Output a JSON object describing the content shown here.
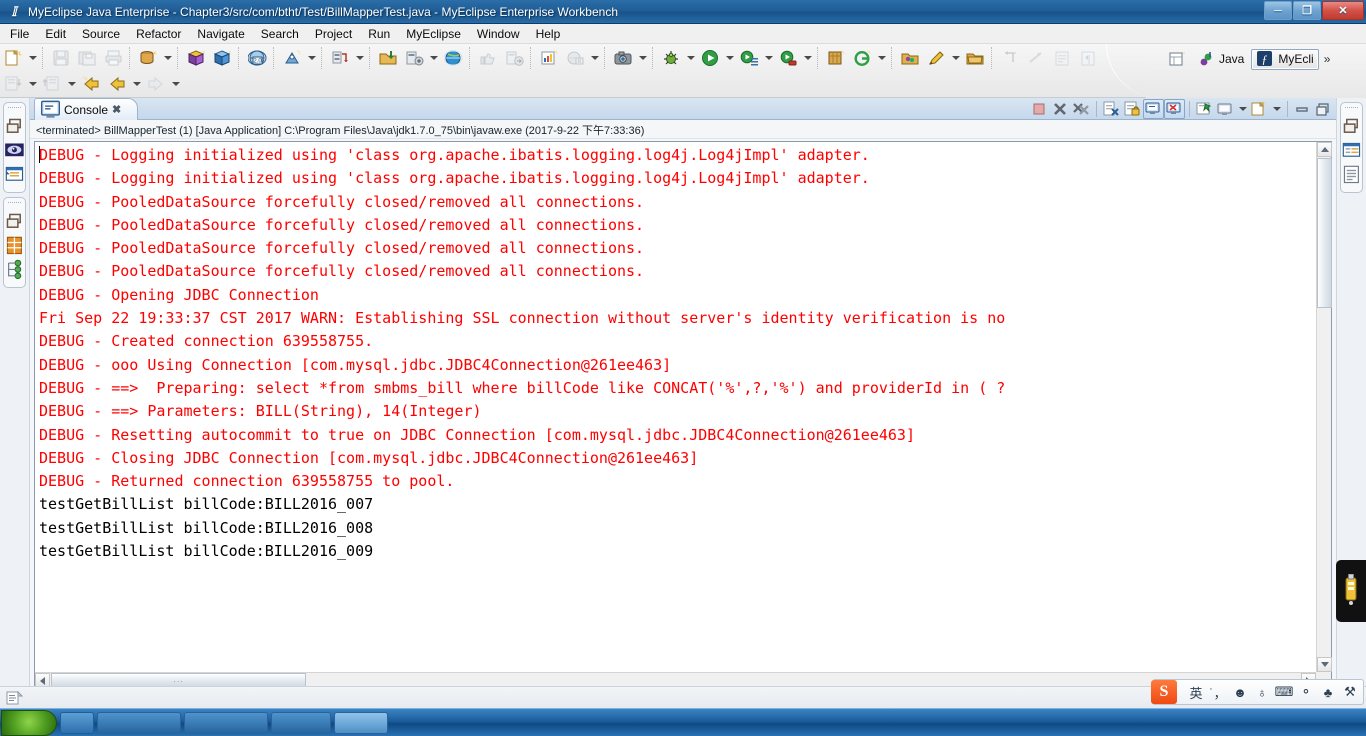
{
  "window": {
    "title": "MyEclipse Java Enterprise - Chapter3/src/com/btht/Test/BillMapperTest.java - MyEclipse Enterprise Workbench",
    "app_icon": "myeclipse-icon",
    "minimize_label": "─",
    "maximize_label": "❐",
    "close_label": "✕"
  },
  "menubar": {
    "items": [
      {
        "label": "File"
      },
      {
        "label": "Edit"
      },
      {
        "label": "Source"
      },
      {
        "label": "Refactor"
      },
      {
        "label": "Navigate"
      },
      {
        "label": "Search"
      },
      {
        "label": "Project"
      },
      {
        "label": "Run"
      },
      {
        "label": "MyEclipse"
      },
      {
        "label": "Window"
      },
      {
        "label": "Help"
      }
    ]
  },
  "perspective": {
    "items": [
      {
        "label": "Java",
        "icon": "java-perspective-icon",
        "active": false
      },
      {
        "label": "MyEcli",
        "icon": "myeclipse-perspective-icon",
        "active": true
      }
    ],
    "overflow_label": "»",
    "open_perspective_icon": "open-perspective-icon"
  },
  "console_view": {
    "tab_label": "Console",
    "tab_icon": "console-icon",
    "tab_close_label": "✖",
    "status_line": "<terminated> BillMapperTest (1) [Java Application] C:\\Program Files\\Java\\jdk1.7.0_75\\bin\\javaw.exe (2017-9-22 下午7:33:36)",
    "toolbar": [
      {
        "name": "terminate-button",
        "icon": "stop-square-icon",
        "pressed": false
      },
      {
        "name": "remove-launch-button",
        "icon": "remove-x-icon",
        "pressed": false
      },
      {
        "name": "remove-all-terminated-button",
        "icon": "remove-all-xx-icon",
        "pressed": false
      },
      {
        "name": "clear-console-button",
        "icon": "clear-console-icon",
        "pressed": false
      },
      {
        "name": "scroll-lock-button",
        "icon": "scroll-lock-icon",
        "pressed": false
      },
      {
        "name": "show-console-on-output-button",
        "icon": "console-out-icon",
        "pressed": true
      },
      {
        "name": "show-console-on-error-button",
        "icon": "console-err-icon",
        "pressed": true
      },
      {
        "name": "pin-console-button",
        "icon": "pin-console-icon",
        "pressed": false
      },
      {
        "name": "display-selected-console-button",
        "icon": "display-console-icon",
        "pressed": false
      },
      {
        "name": "open-console-button",
        "icon": "open-console-icon",
        "pressed": false
      },
      {
        "name": "minimize-view-button",
        "icon": "minimize-icon",
        "pressed": false
      },
      {
        "name": "maximize-view-button",
        "icon": "maximize-icon",
        "pressed": false
      }
    ],
    "output_lines": [
      {
        "text": "DEBUG - Logging initialized using 'class org.apache.ibatis.logging.log4j.Log4jImpl' adapter.",
        "stream": "err"
      },
      {
        "text": "DEBUG - Logging initialized using 'class org.apache.ibatis.logging.log4j.Log4jImpl' adapter.",
        "stream": "err"
      },
      {
        "text": "DEBUG - PooledDataSource forcefully closed/removed all connections.",
        "stream": "err"
      },
      {
        "text": "DEBUG - PooledDataSource forcefully closed/removed all connections.",
        "stream": "err"
      },
      {
        "text": "DEBUG - PooledDataSource forcefully closed/removed all connections.",
        "stream": "err"
      },
      {
        "text": "DEBUG - PooledDataSource forcefully closed/removed all connections.",
        "stream": "err"
      },
      {
        "text": "DEBUG - Opening JDBC Connection",
        "stream": "err"
      },
      {
        "text": "Fri Sep 22 19:33:37 CST 2017 WARN: Establishing SSL connection without server's identity verification is no",
        "stream": "err"
      },
      {
        "text": "DEBUG - Created connection 639558755.",
        "stream": "err"
      },
      {
        "text": "DEBUG - ooo Using Connection [com.mysql.jdbc.JDBC4Connection@261ee463]",
        "stream": "err"
      },
      {
        "text": "DEBUG - ==>  Preparing: select *from smbms_bill where billCode like CONCAT('%',?,'%') and providerId in ( ?",
        "stream": "err"
      },
      {
        "text": "DEBUG - ==> Parameters: BILL(String), 14(Integer)",
        "stream": "err"
      },
      {
        "text": "DEBUG - Resetting autocommit to true on JDBC Connection [com.mysql.jdbc.JDBC4Connection@261ee463]",
        "stream": "err"
      },
      {
        "text": "DEBUG - Closing JDBC Connection [com.mysql.jdbc.JDBC4Connection@261ee463]",
        "stream": "err"
      },
      {
        "text": "DEBUG - Returned connection 639558755 to pool.",
        "stream": "err"
      },
      {
        "text": "testGetBillList billCode:BILL2016_007",
        "stream": "out"
      },
      {
        "text": "testGetBillList billCode:BILL2016_008",
        "stream": "out"
      },
      {
        "text": "testGetBillList billCode:BILL2016_009",
        "stream": "out"
      }
    ],
    "scrollbars": {
      "vertical": {
        "up_icon": "scroll-up-arrow-icon",
        "down_icon": "scroll-down-arrow-icon"
      },
      "horizontal": {
        "left_icon": "scroll-left-arrow-icon",
        "right_icon": "scroll-right-arrow-icon",
        "grip_label": "∙∙∙"
      }
    }
  },
  "toolbar": {
    "row1": [
      {
        "name": "new-wizard-button",
        "icon": "new-file-icon",
        "dropdown": true
      },
      {
        "sep": true
      },
      {
        "name": "save-button",
        "icon": "save-disk-icon",
        "disabled": true
      },
      {
        "name": "save-all-button",
        "icon": "save-all-icon",
        "disabled": true
      },
      {
        "name": "print-button",
        "icon": "printer-icon",
        "disabled": true
      },
      {
        "sep": true
      },
      {
        "name": "myeclipse-database-explorer-button",
        "icon": "db-sparkle-icon",
        "dropdown": true
      },
      {
        "sep": true
      },
      {
        "name": "new-ejb-project-button",
        "icon": "cube-purple-icon"
      },
      {
        "name": "new-web-project-button",
        "icon": "cube-blue-icon"
      },
      {
        "sep": true
      },
      {
        "name": "new-web20-project-button",
        "icon": "globe-20-icon"
      },
      {
        "sep": true
      },
      {
        "name": "deploy-tool-button",
        "icon": "deploy-sparkle-icon",
        "dropdown": true
      },
      {
        "sep": true
      },
      {
        "name": "server-deploy-button",
        "icon": "server-deploy-icon",
        "dropdown": true
      },
      {
        "sep": true
      },
      {
        "name": "import-button",
        "icon": "import-folder-icon"
      },
      {
        "name": "manage-deployments-button",
        "icon": "manage-deploy-icon",
        "dropdown": true
      },
      {
        "name": "open-browser-button",
        "icon": "globe-icon"
      },
      {
        "sep": true
      },
      {
        "name": "thumbs-up-button",
        "icon": "thumbs-up-icon",
        "disabled": true
      },
      {
        "name": "export-button",
        "icon": "export-arrow-icon",
        "disabled": true
      },
      {
        "sep": true
      },
      {
        "name": "new-report-button",
        "icon": "report-sparkle-icon"
      },
      {
        "name": "run-report-button",
        "icon": "report-run-icon",
        "disabled": true,
        "dropdown": true
      },
      {
        "sep": true
      },
      {
        "name": "snapshot-button",
        "icon": "camera-icon",
        "dropdown": true
      },
      {
        "sep": true
      },
      {
        "name": "debug-button",
        "icon": "debug-bug-icon",
        "dropdown": true
      },
      {
        "name": "run-button",
        "icon": "run-green-play-icon",
        "dropdown": true
      },
      {
        "name": "run-history-button",
        "icon": "run-history-icon",
        "dropdown": true
      },
      {
        "name": "run-external-tools-button",
        "icon": "external-tools-icon",
        "dropdown": true
      },
      {
        "sep": true
      },
      {
        "name": "new-class-button",
        "icon": "new-class-icon"
      },
      {
        "name": "new-package-button",
        "icon": "new-package-g-icon",
        "dropdown": true
      },
      {
        "sep": true
      },
      {
        "name": "open-type-button",
        "icon": "open-type-icon"
      },
      {
        "name": "search-button",
        "icon": "search-pen-icon",
        "dropdown": true
      },
      {
        "name": "open-resource-button",
        "icon": "open-resource-icon"
      },
      {
        "sep": true
      },
      {
        "name": "next-annotation-button",
        "icon": "next-annotation-icon",
        "disabled": true
      },
      {
        "name": "previous-annotation-button",
        "icon": "previous-annotation-icon",
        "disabled": true
      },
      {
        "name": "toggle-block-selection-button",
        "icon": "block-selection-icon",
        "disabled": true
      },
      {
        "name": "show-whitespace-button",
        "icon": "pilcrow-icon",
        "disabled": true
      }
    ],
    "row2": [
      {
        "name": "import-project-button",
        "icon": "import-down-icon",
        "disabled": true,
        "dropdown": true
      },
      {
        "name": "export-project-button",
        "icon": "export-up-icon",
        "disabled": true,
        "dropdown": true
      },
      {
        "name": "back-to-last-edit-button",
        "icon": "back-yellow-sparkle-icon"
      },
      {
        "name": "back-button",
        "icon": "back-arrow-icon",
        "dropdown": true
      },
      {
        "name": "forward-button",
        "icon": "forward-arrow-icon",
        "disabled": true,
        "dropdown": true
      }
    ]
  },
  "fastviews": {
    "left": [
      {
        "name": "fastview-restore-group-1",
        "icon": "restore-window-icon"
      },
      {
        "name": "fastview-eye",
        "icon": "eye-icon"
      },
      {
        "name": "fastview-outline",
        "icon": "outline-list-icon"
      },
      {
        "name": "fastview-restore-group-2",
        "icon": "restore-window-icon"
      },
      {
        "name": "fastview-grid",
        "icon": "orange-grid-icon"
      },
      {
        "name": "fastview-hierarchy",
        "icon": "green-nodes-icon"
      }
    ],
    "right": [
      {
        "name": "fastview-restore-group-3",
        "icon": "restore-window-icon"
      },
      {
        "name": "fastview-properties",
        "icon": "properties-icon"
      },
      {
        "name": "fastview-document",
        "icon": "document-lines-icon"
      }
    ]
  },
  "workbench_status": {
    "icon": "writable-insert-icon"
  },
  "tray": {
    "usb_icon": "usb-device-icon"
  },
  "ime": {
    "logo_label": "S",
    "mode_label": "英",
    "buttons": [
      {
        "name": "ime-mode-button",
        "label": "英"
      },
      {
        "name": "ime-punctuation-button",
        "label": "˙，"
      },
      {
        "name": "ime-emoji-button",
        "label": "☻"
      },
      {
        "name": "ime-voice-button",
        "label": "♁"
      },
      {
        "name": "ime-softkeyboard-button",
        "label": "⌨"
      },
      {
        "name": "ime-user-button",
        "label": "⚬"
      },
      {
        "name": "ime-skin-button",
        "label": "♣"
      },
      {
        "name": "ime-tools-button",
        "label": "⚒"
      }
    ]
  },
  "taskbar": {
    "start_label": "",
    "items": [
      {
        "name": "taskbar-quicklaunch-1",
        "label": ""
      },
      {
        "name": "taskbar-quicklaunch-2",
        "label": ""
      },
      {
        "name": "taskbar-window-1",
        "label": ""
      },
      {
        "name": "taskbar-window-2",
        "label": ""
      }
    ]
  }
}
